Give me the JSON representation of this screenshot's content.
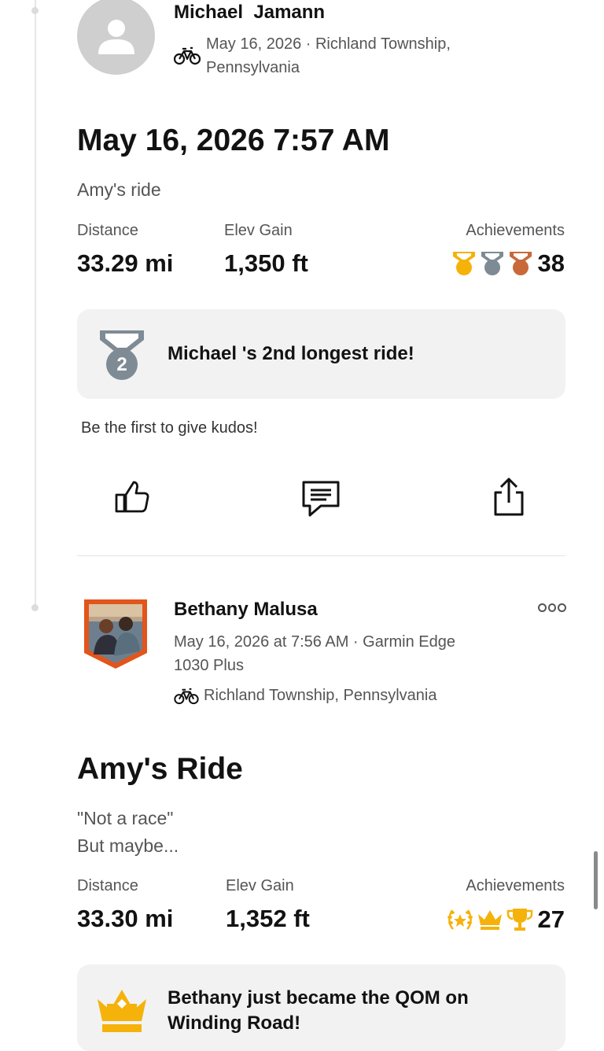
{
  "feed": [
    {
      "athlete": "Michael  Jamann",
      "meta_line1": "May 16, 2026 · Richland Township,",
      "meta_line2": "Pennsylvania",
      "title": "May 16, 2026 7:57 AM",
      "description_line1": "Amy's ride",
      "stats": {
        "distance_label": "Distance",
        "distance": "33.29 mi",
        "elev_label": "Elev Gain",
        "elev": "1,350 ft",
        "achievements_label": "Achievements",
        "achievements": "38",
        "achievement_icons": [
          "gold-medal-icon",
          "silver-medal-icon",
          "bronze-medal-icon"
        ]
      },
      "highlight": {
        "icon": "silver-medal-2-icon",
        "text": "Michael 's 2nd longest ride!",
        "medal_number": "2"
      },
      "kudos_prompt": "Be the first to give kudos!",
      "actions": [
        "thumbs-up-icon",
        "comment-icon",
        "share-icon"
      ]
    },
    {
      "athlete": "Bethany Malusa",
      "meta_line1": "May 16, 2026 at 7:56 AM · Garmin Edge",
      "meta_line2": "1030 Plus",
      "location": "Richland Township, Pennsylvania",
      "title": "Amy's Ride",
      "description_line1": "\"Not a race\"",
      "description_line2": "But maybe...",
      "stats": {
        "distance_label": "Distance",
        "distance": "33.30 mi",
        "elev_label": "Elev Gain",
        "elev": "1,352 ft",
        "achievements_label": "Achievements",
        "achievements": "27",
        "achievement_icons": [
          "laurel-icon",
          "crown-icon",
          "trophy-icon"
        ]
      },
      "highlight": {
        "icon": "crown-icon",
        "line1": "Bethany just became the QOM on",
        "line2": "Winding Road!"
      }
    }
  ],
  "colors": {
    "gold": "#f5b20b",
    "silver": "#7e8b94",
    "bronze": "#c8693a",
    "club_orange": "#e2551b"
  }
}
